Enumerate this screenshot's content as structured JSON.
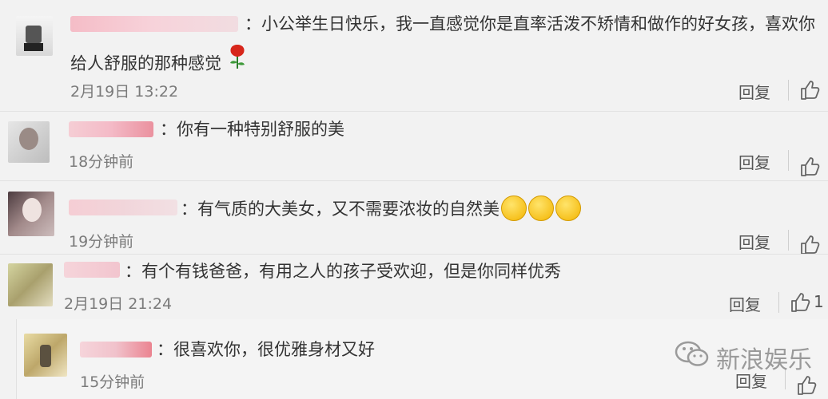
{
  "comments": [
    {
      "text": "：小公举生日快乐，我一直感觉你是直率活泼不矫情和做作的好女孩，喜欢你",
      "text2": "给人舒服的那种感觉",
      "time": "2月19日 13:22",
      "reply": "回复"
    },
    {
      "text": "：你有一种特别舒服的美",
      "time": "18分钟前",
      "reply": "回复"
    },
    {
      "text": "：有气质的大美女，又不需要浓妆的自然美",
      "time": "19分钟前",
      "reply": "回复"
    },
    {
      "text": "：有个有钱爸爸，有用之人的孩子受欢迎，但是你同样优秀",
      "time": "2月19日 21:24",
      "reply": "回复",
      "likes": "1"
    },
    {
      "text": "：很喜欢你，很优雅身材又好",
      "time": "15分钟前",
      "reply": "回复"
    }
  ],
  "watermark": {
    "label": "新浪娱乐"
  },
  "icons": {
    "like": "thumbs-up-icon",
    "rose": "rose-icon",
    "emoji": "teary-face-icon",
    "watermark": "wechat-icon"
  }
}
